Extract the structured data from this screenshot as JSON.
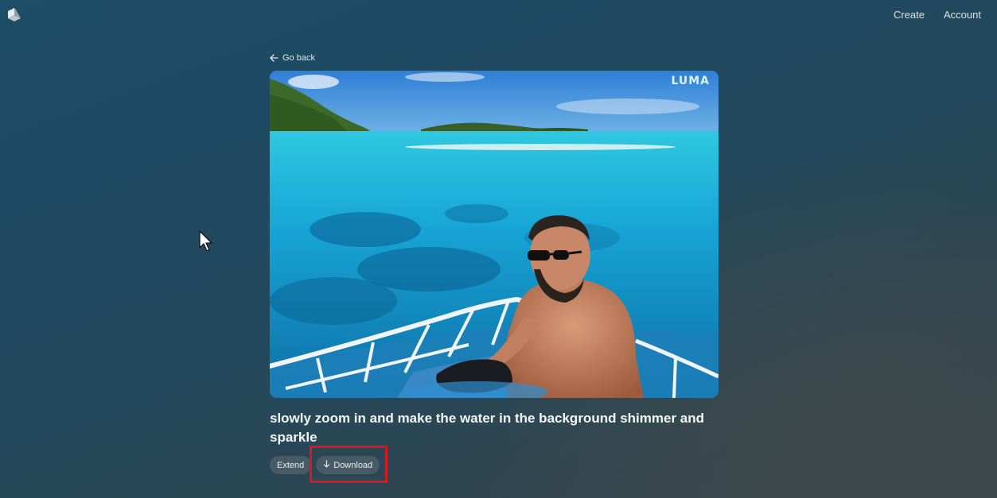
{
  "header": {
    "logo_icon": "luma-cube-logo-icon",
    "nav": [
      {
        "label": "Create"
      },
      {
        "label": "Account"
      }
    ]
  },
  "goback": {
    "icon": "arrow-left-icon",
    "label": "Go back"
  },
  "video": {
    "watermark": "LUMA",
    "description": "Generated video frame"
  },
  "prompt": {
    "text": "slowly zoom in and make the water in the background shimmer and sparkle"
  },
  "actions": {
    "extend_label": "Extend",
    "download_icon": "arrow-down-icon",
    "download_label": "Download"
  },
  "annotation": {
    "highlight_color": "#e0141c"
  }
}
